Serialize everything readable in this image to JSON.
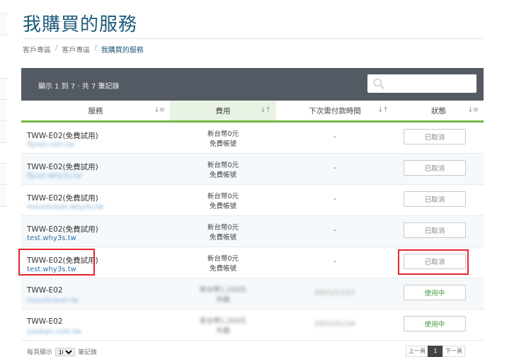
{
  "page": {
    "title": "我購買的服務"
  },
  "breadcrumb": [
    "客戶專區",
    "客戶專區",
    "我購買的服務"
  ],
  "toolbar": {
    "count_text": "顯示 1 到 7 · 共 7 筆記錄",
    "search_placeholder": ""
  },
  "table": {
    "headers": [
      "服務",
      "費用",
      "下次需付款時間",
      "狀態"
    ],
    "rows": [
      {
        "service": "TWW-E02(免費試用)",
        "domain": "flyvel.com.tw",
        "fee1": "新台幣0元",
        "fee2": "免費帳號",
        "due": "-",
        "status": "已取消"
      },
      {
        "service": "TWW-E02(免費試用)",
        "domain": "flyvel.why3s.tw",
        "fee1": "新台幣0元",
        "fee2": "免費帳號",
        "due": "-",
        "status": "已取消"
      },
      {
        "service": "TWW-E02(免費試用)",
        "domain": "mountravel.why3s.tw",
        "fee1": "新台幣0元",
        "fee2": "免費帳號",
        "due": "-",
        "status": "已取消"
      },
      {
        "service": "TWW-E02(免費試用)",
        "domain": "test.why3s.tw",
        "fee1": "新台幣0元",
        "fee2": "免費帳號",
        "due": "-",
        "status": "已取消"
      },
      {
        "service": "TWW-E02(免費試用)",
        "domain": "test.why3s.tw",
        "fee1": "新台幣0元",
        "fee2": "免費帳號",
        "due": "-",
        "status": "已取消"
      },
      {
        "service": "TWW-E02",
        "domain": "mountravel.tw",
        "fee1": "新台幣1,200元",
        "fee2": "年繳",
        "due": "2021/11/12",
        "status": "使用中"
      },
      {
        "service": "TWW-E02",
        "domain": "yaoban.com.tw",
        "fee1": "新台幣1,200元",
        "fee2": "年繳",
        "due": "2022/01/16",
        "status": "使用中"
      }
    ]
  },
  "footer": {
    "per_page_prefix": "每頁顯示",
    "per_page_value": "10",
    "per_page_suffix": "筆記錄",
    "pages": [
      "上一頁",
      "1",
      "下一頁"
    ]
  },
  "colors": {
    "accent_green": "#72b944",
    "title_blue": "#1b5a7a",
    "highlight_red": "#e5262a",
    "toolbar": "#545a63"
  }
}
